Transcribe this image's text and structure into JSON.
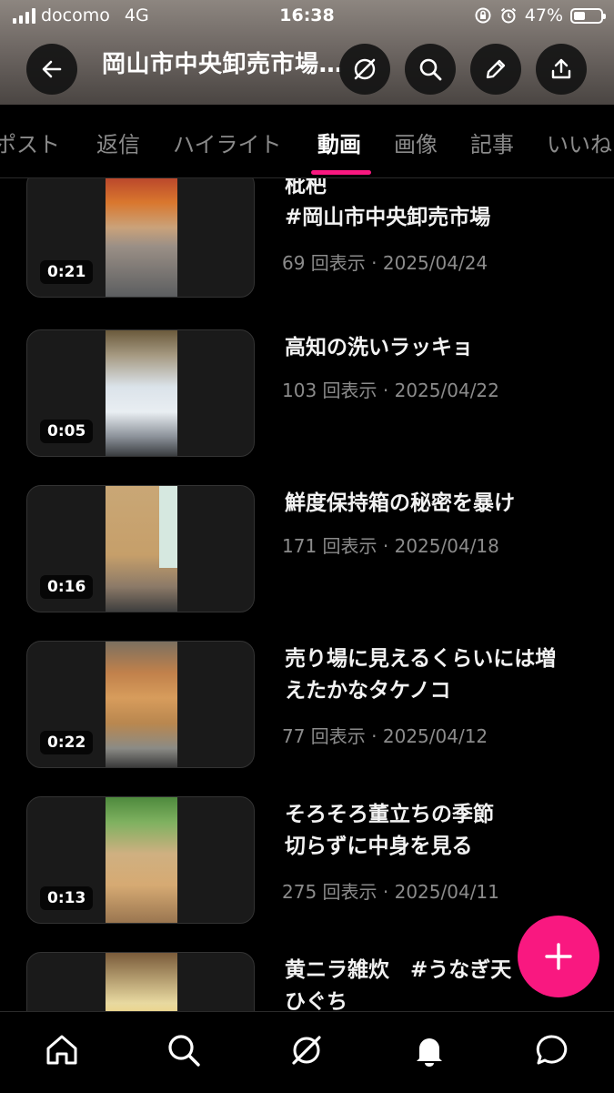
{
  "status_bar": {
    "carrier": "docomo",
    "network": "4G",
    "time": "16:38",
    "battery": "47%",
    "battery_level": 0.47
  },
  "header": {
    "title": "岡山市中央卸売市場…",
    "back_icon": "arrow-left-icon",
    "actions": [
      "grok-icon",
      "search-icon",
      "edit-icon",
      "share-icon"
    ]
  },
  "tabs": [
    {
      "label": "ポスト",
      "active": false
    },
    {
      "label": "返信",
      "active": false
    },
    {
      "label": "ハイライト",
      "active": false
    },
    {
      "label": "動画",
      "active": true
    },
    {
      "label": "画像",
      "active": false
    },
    {
      "label": "記事",
      "active": false
    },
    {
      "label": "いいね",
      "active": false
    }
  ],
  "videos": [
    {
      "duration": "0:21",
      "title": "枇杷\n#岡山市中央卸売市場",
      "meta": "69 回表示 · 2025/04/24"
    },
    {
      "duration": "0:05",
      "title": "高知の洗いラッキョ",
      "meta": "103 回表示 · 2025/04/22"
    },
    {
      "duration": "0:16",
      "title": "鮮度保持箱の秘密を暴け",
      "meta": "171 回表示 · 2025/04/18"
    },
    {
      "duration": "0:22",
      "title": "売り場に見えるくらいには増\nえたかなタケノコ",
      "meta": "77 回表示 · 2025/04/12"
    },
    {
      "duration": "0:13",
      "title": "そろそろ董立ちの季節\n切らずに中身を見る",
      "meta": "275 回表示 · 2025/04/11"
    },
    {
      "duration": "",
      "title": "黄ニラ雑炊　#うなぎ天\nひぐち",
      "meta": ""
    }
  ],
  "fab": {
    "icon": "plus-icon"
  },
  "bottom_nav": [
    "home-icon",
    "search-icon",
    "grok-icon",
    "bell-icon",
    "message-icon"
  ],
  "colors": {
    "accent": "#f91880",
    "background": "#000000",
    "muted_text": "#8b8b8b"
  }
}
